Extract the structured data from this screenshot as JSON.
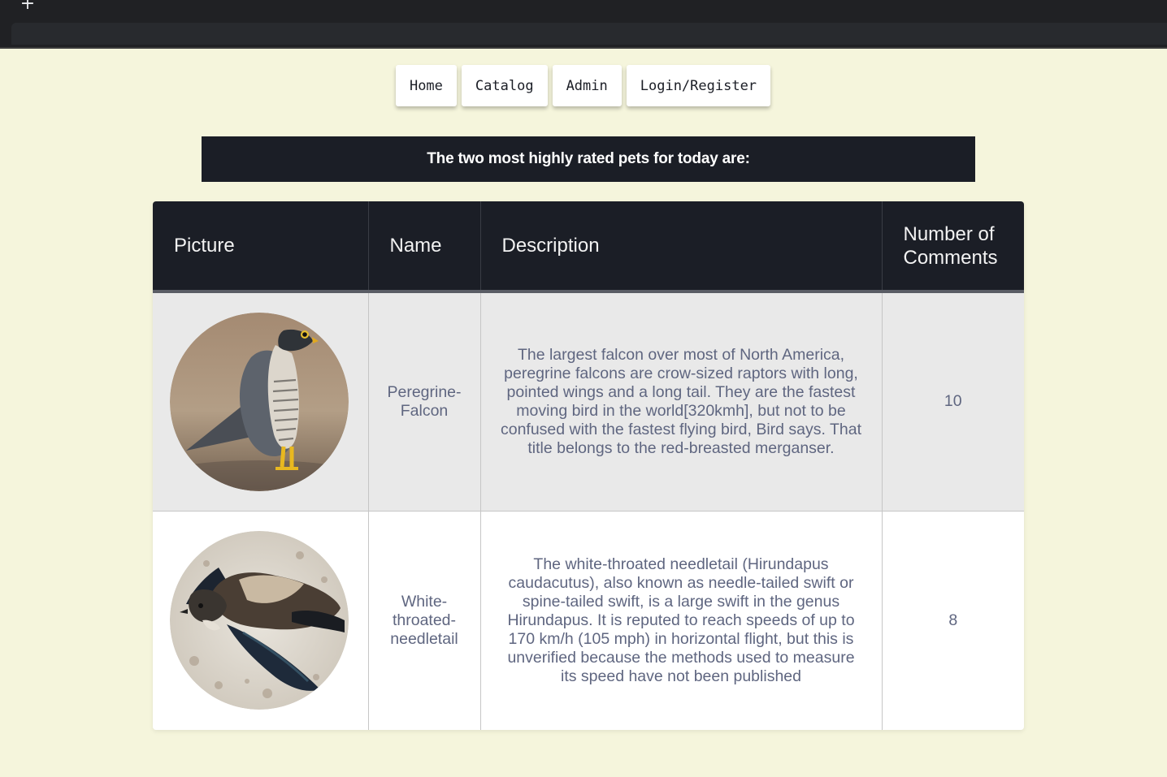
{
  "browser": {
    "new_tab_symbol": "+"
  },
  "nav": {
    "items": [
      {
        "label": "Home"
      },
      {
        "label": "Catalog"
      },
      {
        "label": "Admin"
      },
      {
        "label": "Login/Register"
      }
    ]
  },
  "banner": {
    "text": "The two most highly rated pets for today are:"
  },
  "table": {
    "headers": {
      "picture": "Picture",
      "name": "Name",
      "description": "Description",
      "comments_line1": "Number of",
      "comments_line2": "Comments"
    },
    "rows": [
      {
        "name_line1": "Peregrine-",
        "name_line2": "Falcon",
        "description": "The largest falcon over most of North America, peregrine falcons are crow-sized raptors with long, pointed wings and a long tail. They are the fastest moving bird in the world[320kmh], but not to be confused with the fastest flying bird, Bird says. That title belongs to the red-breasted merganser.",
        "comments": "10",
        "picture_subject": "peregrine-falcon-photo"
      },
      {
        "name_line1": "White-",
        "name_line2": "throated-",
        "name_line3": "needletail",
        "description": "The white-throated needletail (Hirundapus caudacutus), also known as needle-tailed swift or spine-tailed swift, is a large swift in the genus Hirundapus. It is reputed to reach speeds of up to 170 km/h (105 mph) in horizontal flight, but this is unverified because the methods used to measure its speed have not been published",
        "comments": "8",
        "picture_subject": "needletail-swift-photo"
      }
    ]
  },
  "colors": {
    "page_background": "#f5f5dc",
    "dark": "#1b1e26",
    "cell_text": "#5f6680",
    "row_alt": "#e9e9e9"
  }
}
